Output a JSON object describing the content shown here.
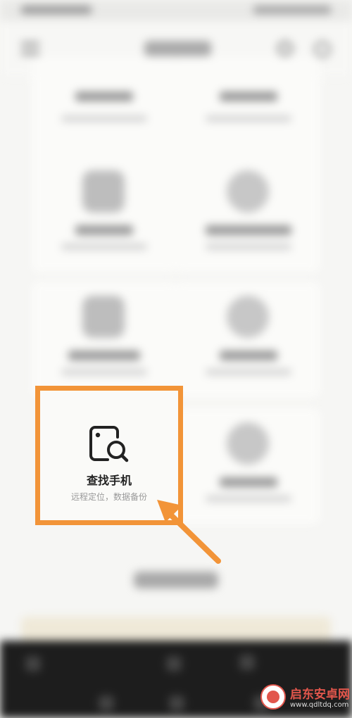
{
  "find_phone": {
    "title": "查找手机",
    "subtitle": "远程定位，数据备份"
  },
  "watermark": {
    "name": "启东安卓网",
    "url": "www.qdltdq.com"
  },
  "colors": {
    "highlight": "#f29438",
    "watermark": "#e2564c"
  }
}
